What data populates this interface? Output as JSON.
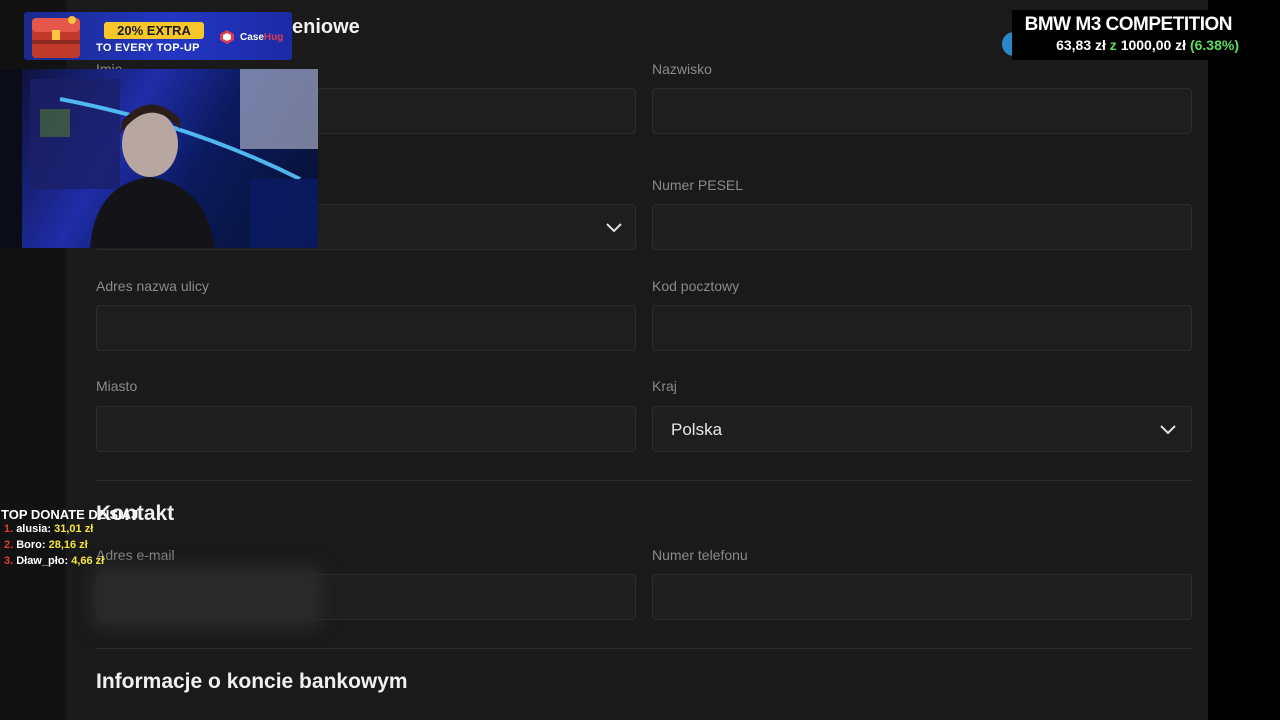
{
  "form": {
    "section_personal_title_fragment": "eniowe",
    "labels": {
      "first_name": "Imię",
      "last_name": "Nazwisko",
      "pesel": "Numer PESEL",
      "street": "Adres nazwa ulicy",
      "postal_code": "Kod pocztowy",
      "city": "Miasto",
      "country": "Kraj",
      "email": "Adres e-mail",
      "phone": "Numer telefonu"
    },
    "values": {
      "country": "Polska"
    },
    "section_contact_title": "Kontakt",
    "section_bank_title": "Informacje o koncie bankowym"
  },
  "overlay": {
    "promo": {
      "headline": "20% EXTRA",
      "subline": "TO EVERY TOP-UP",
      "brand_case": "Case",
      "brand_hug": "Hug"
    },
    "goal": {
      "title": "BMW M3 COMPETITION",
      "current": "63,83 zł",
      "sep": "z",
      "target": "1000,00 zł",
      "percent": "(6.38%)",
      "progress_fraction": 0.0638
    },
    "top_donate": {
      "title": "TOP DONATE DZISIAJ",
      "entries": [
        {
          "rank": "1.",
          "name": "alusia:",
          "amount": "31,01 zł"
        },
        {
          "rank": "2.",
          "name": "Boro:",
          "amount": "28,16 zł"
        },
        {
          "rank": "3.",
          "name": "Dław_pło:",
          "amount": "4,66 zł"
        }
      ]
    }
  },
  "colors": {
    "accent_green": "#5ddc5d",
    "promo_yellow": "#f7c62a",
    "promo_blue": "#2336c4",
    "donate_amount": "#f5e63a"
  }
}
